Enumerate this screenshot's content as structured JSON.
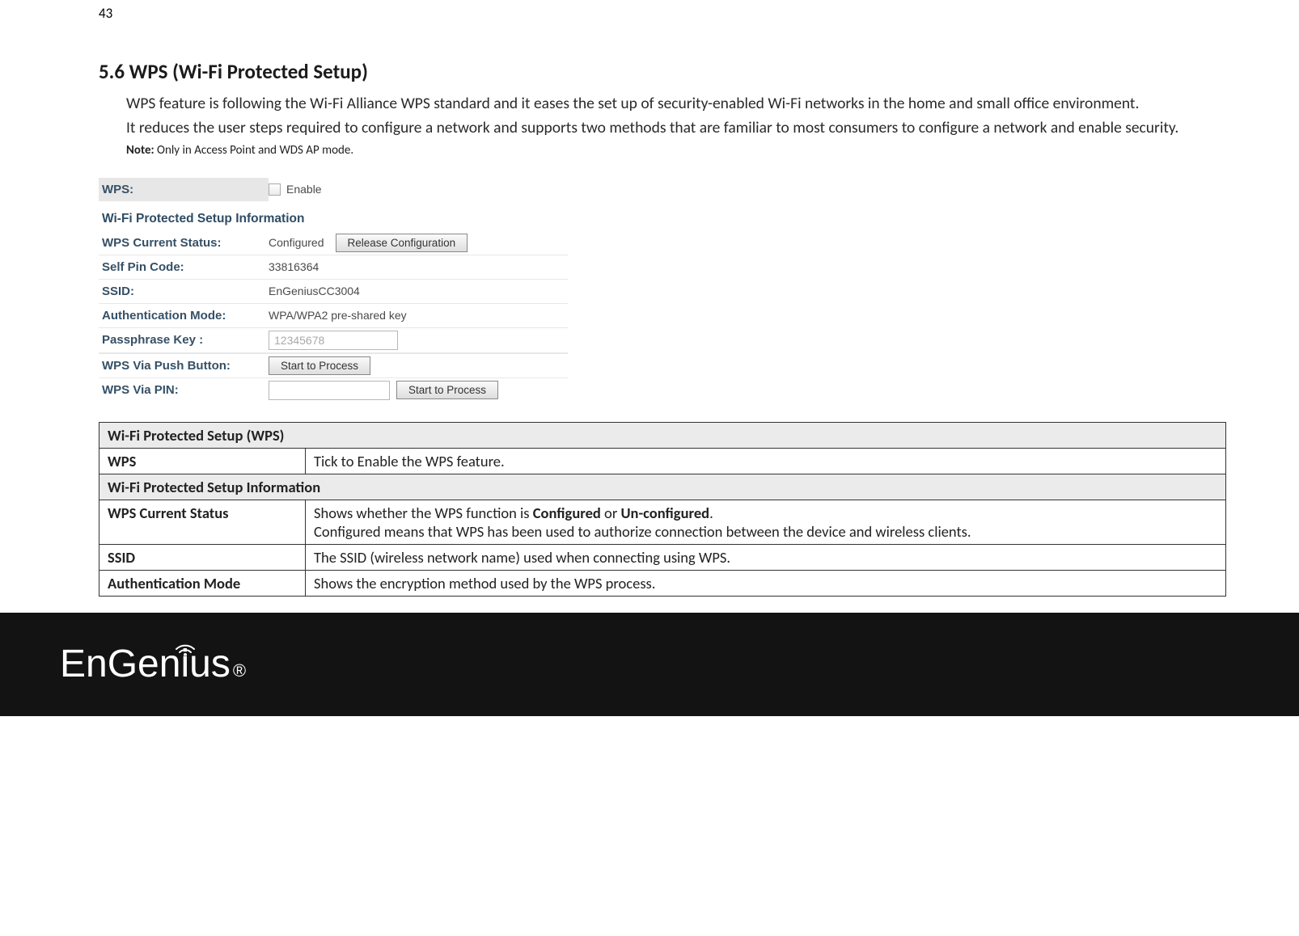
{
  "page_number": "43",
  "heading": "5.6    WPS (Wi-Fi Protected Setup)",
  "para1": "WPS feature is following the Wi-Fi Alliance WPS standard and it eases the set up of security-enabled Wi-Fi networks in the home and small office environment.",
  "para2": "It reduces the user steps required to configure a network and supports two methods that are familiar to most consumers to configure a network and enable security.",
  "note_bold": "Note: ",
  "note_rest": "Only in Access Point and WDS AP mode.",
  "screenshot": {
    "wps_label": "WPS:",
    "enable_label": "Enable",
    "info_heading": "Wi-Fi Protected Setup Information",
    "rows": {
      "current_status_label": "WPS Current Status:",
      "current_status_value": "Configured",
      "release_btn": "Release Configuration",
      "self_pin_label": "Self Pin Code:",
      "self_pin_value": "33816364",
      "ssid_label": "SSID:",
      "ssid_value": "EnGeniusCC3004",
      "auth_mode_label": "Authentication Mode:",
      "auth_mode_value": "WPA/WPA2 pre-shared key",
      "passphrase_label": "Passphrase Key :",
      "passphrase_value": "12345678",
      "push_btn_label": "WPS Via Push Button:",
      "start_process_btn": "Start to Process",
      "pin_label": "WPS Via PIN:",
      "start_process_btn2": "Start to Process"
    }
  },
  "table": {
    "hdr1": "Wi-Fi Protected Setup (WPS)",
    "wps_key": "WPS",
    "wps_desc": "Tick to Enable the WPS feature.",
    "hdr2": "Wi-Fi Protected Setup Information",
    "cur_key": "WPS Current Status",
    "cur_desc_pre": "Shows whether the WPS function is ",
    "cur_desc_b1": "Configured",
    "cur_desc_mid": " or ",
    "cur_desc_b2": "Un-configured",
    "cur_desc_post": ".",
    "cur_desc_line2": "Configured means that WPS has been used to authorize connection between the device and wireless clients.",
    "ssid_key": "SSID",
    "ssid_desc": "The SSID (wireless network name) used when connecting using WPS.",
    "auth_key": "Authentication Mode",
    "auth_desc": "Shows the encryption method used by the WPS process."
  },
  "logo": {
    "part1": "En",
    "part2": "Gen",
    "part3": "i",
    "part4": "us",
    "reg": "®"
  }
}
